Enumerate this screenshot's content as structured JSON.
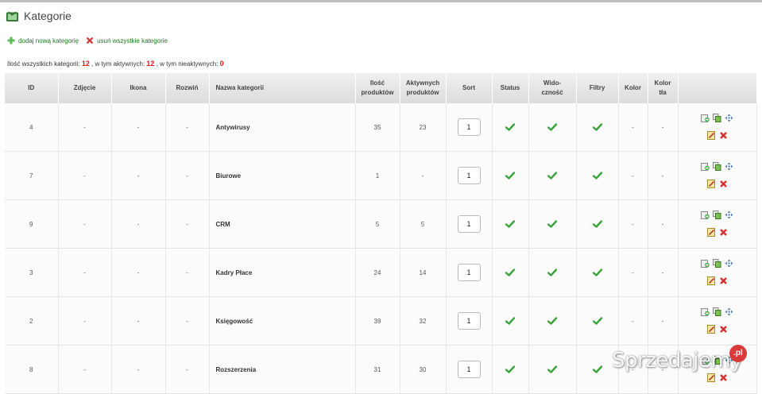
{
  "page": {
    "title": "Kategorie"
  },
  "actions": {
    "add_label": "dodaj nową kategorię",
    "delete_all_label": "usuń wszystkie kategorie"
  },
  "summary": {
    "prefix": "Ilość wszystkich kategorii: ",
    "total": "12",
    "active_text": " , w tym aktywnych: ",
    "active": "12",
    "inactive_text": " , w tym nieaktywnych: ",
    "inactive": "0"
  },
  "table": {
    "headers": {
      "id": "ID",
      "photo": "Zdjęcie",
      "icon": "Ikona",
      "expand": "Rozwiń",
      "name": "Nazwa kategorii",
      "products_1": "Ilość",
      "products_2": "produktów",
      "active_1": "Aktywnych",
      "active_2": "produktów",
      "sort": "Sort",
      "status": "Status",
      "visibility_1": "Wido-",
      "visibility_2": "czność",
      "filters": "Filtry",
      "color": "Kolor",
      "bgcolor_1": "Kolor",
      "bgcolor_2": "tła"
    },
    "rows": [
      {
        "id": "4",
        "photo": "-",
        "icon": "-",
        "expand": "-",
        "name": "Antywirusy",
        "products": "35",
        "active": "23",
        "sort": "1",
        "color": "-",
        "bgcolor": "-"
      },
      {
        "id": "7",
        "photo": "-",
        "icon": "-",
        "expand": "-",
        "name": "Biurowe",
        "products": "1",
        "active": "-",
        "sort": "1",
        "color": "-",
        "bgcolor": "-"
      },
      {
        "id": "9",
        "photo": "-",
        "icon": "-",
        "expand": "-",
        "name": "CRM",
        "products": "5",
        "active": "5",
        "sort": "1",
        "color": "-",
        "bgcolor": "-"
      },
      {
        "id": "3",
        "photo": "-",
        "icon": "-",
        "expand": "-",
        "name": "Kadry Płace",
        "products": "24",
        "active": "14",
        "sort": "1",
        "color": "-",
        "bgcolor": "-"
      },
      {
        "id": "2",
        "photo": "-",
        "icon": "-",
        "expand": "-",
        "name": "Księgowość",
        "products": "39",
        "active": "32",
        "sort": "1",
        "color": "-",
        "bgcolor": "-"
      },
      {
        "id": "8",
        "photo": "-",
        "icon": "-",
        "expand": "-",
        "name": "Rozszerzenia",
        "products": "31",
        "active": "30",
        "sort": "1",
        "color": "-",
        "bgcolor": "-"
      }
    ]
  },
  "watermark": {
    "text": "Sprzedajemy",
    "badge": ".pl"
  },
  "colors": {
    "link_green": "#1f7a1f",
    "count_red": "#e01a1a",
    "check_green": "#3aa23a",
    "delete_red": "#d32f2f"
  }
}
